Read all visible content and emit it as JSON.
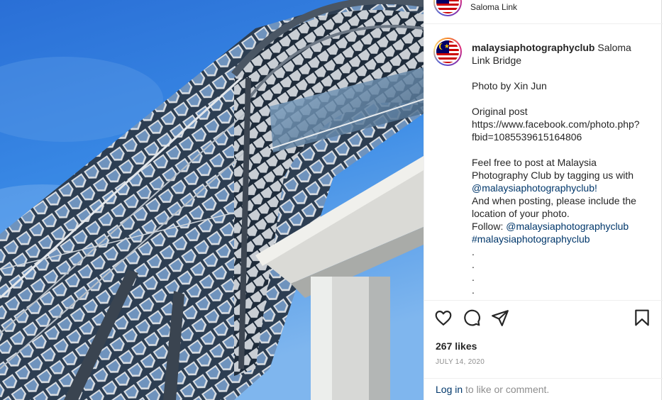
{
  "post": {
    "location": "Saloma Link",
    "image_alt": "Saloma Link Bridge photo",
    "caption": {
      "username": "malaysiaphotographyclub",
      "title": " Saloma Link Bridge",
      "photo_by": "Photo by Xin Jun",
      "original_label": "Original post",
      "original_url": "https://www.facebook.com/photo.php?fbid=1085539615164806",
      "feel_free": "Feel free to post at Malaysia Photography Club by tagging us with ",
      "mention_tag": "@malaysiaphotographyclub!",
      "when_posting": "And when posting, please include the location of your photo.",
      "follow_label": "Follow: ",
      "follow_handle": "@malaysiaphotographyclub",
      "hashtag": "#malaysiaphotographyclub",
      "dots": ".\n.\n.\n."
    },
    "likes": "267 likes",
    "date": "JULY 14, 2020",
    "login_link": "Log in",
    "login_text": " to like or comment.",
    "more_icon": "more-dots-icon"
  },
  "icons": {
    "like": "heart-icon",
    "comment": "comment-bubble-icon",
    "share": "paper-plane-icon",
    "save": "bookmark-icon"
  },
  "colors": {
    "link": "#00376b",
    "muted": "#8e8e8e",
    "text": "#262626",
    "sky": "#1f6fd0"
  }
}
